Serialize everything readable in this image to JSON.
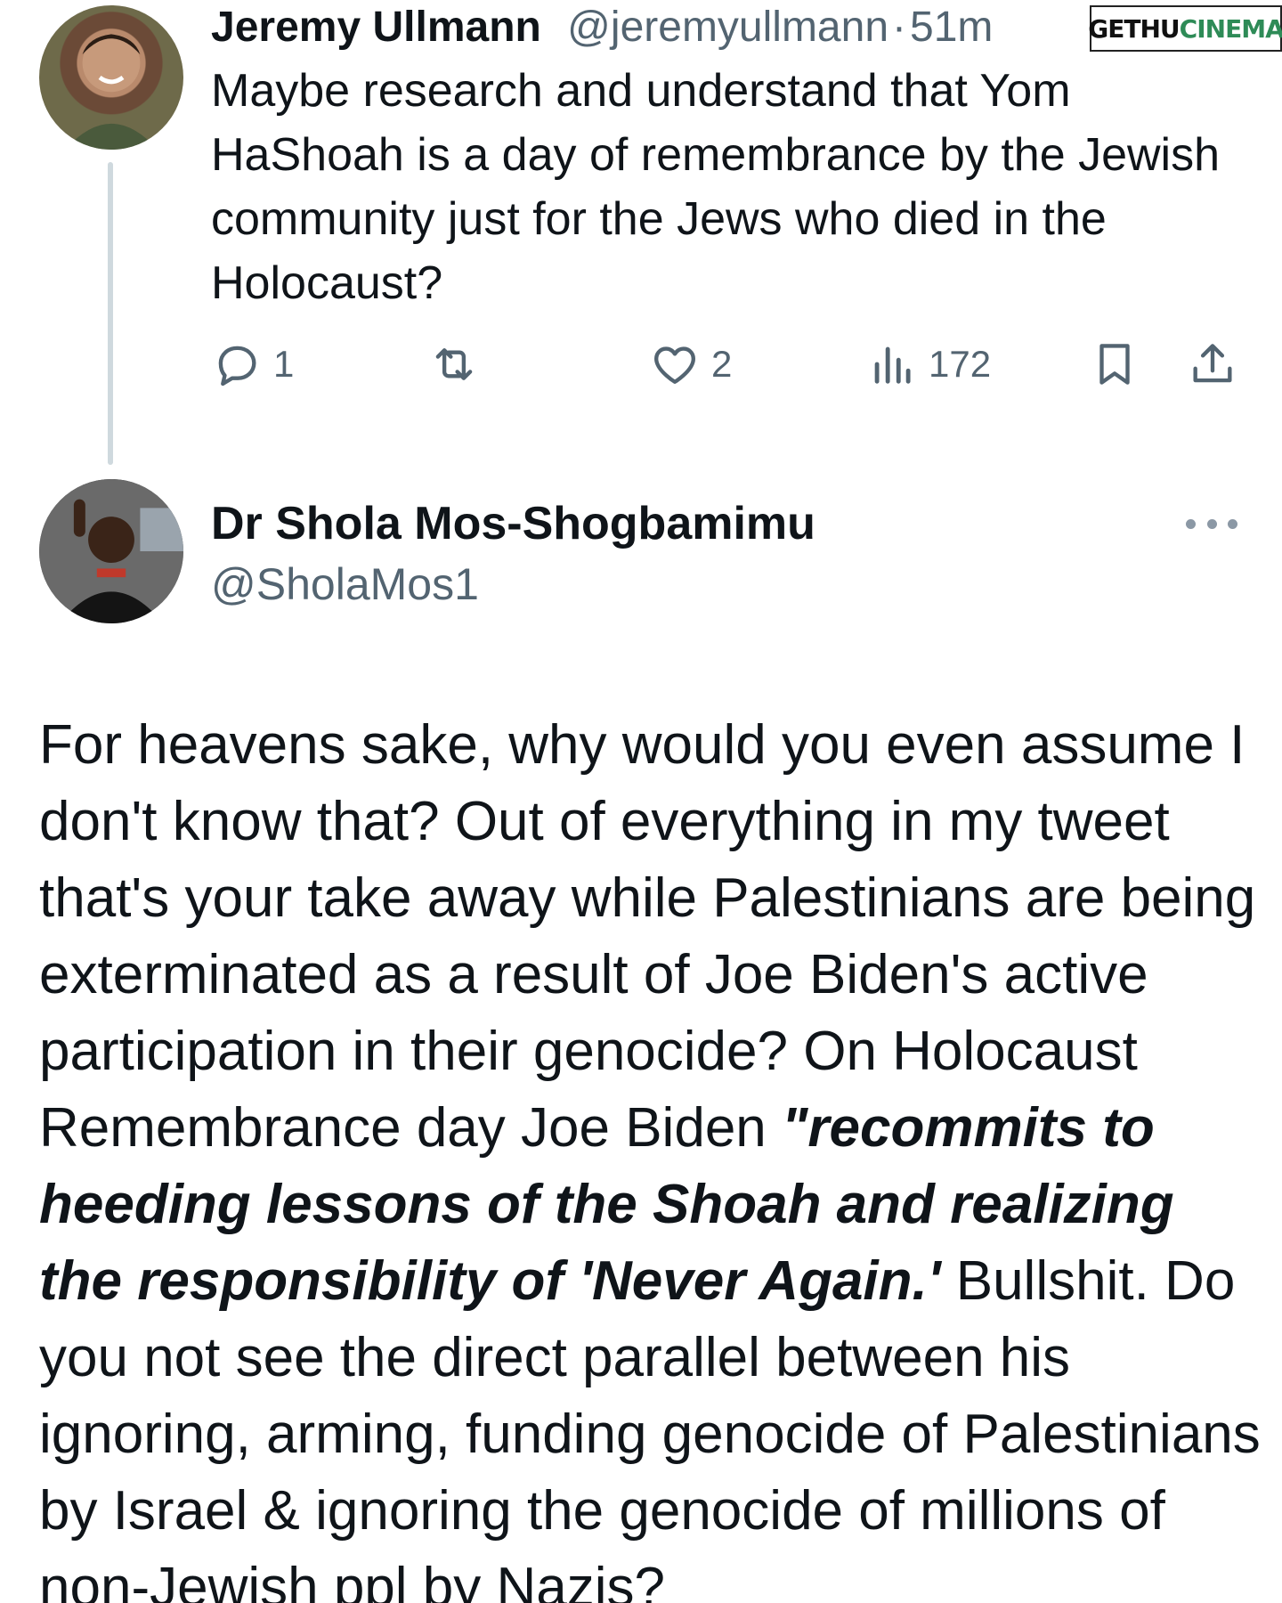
{
  "watermark": {
    "part1": "GETHU",
    "part2": "CINEMA"
  },
  "parent_tweet": {
    "author_name": "Jeremy Ullmann",
    "handle": "@jeremyullmann",
    "separator": "·",
    "time": "51m",
    "text": "Maybe research and understand that Yom HaShoah is a day of remembrance by the Jewish community just for the Jews who died in the Holocaust?",
    "replies": "1",
    "likes": "2",
    "views": "172"
  },
  "reply_tweet": {
    "author_name": "Dr Shola Mos-Shogbamimu",
    "handle": "@SholaMos1",
    "text_part1": "For heavens sake, why would you even assume I don't know that? Out of everything in my tweet that's your take away while Palestinians are being exterminated as a result of Joe Biden's active participation in their genocide? On Holocaust Remembrance day Joe Biden ",
    "text_quote": "\"recommits to heeding lessons of the Shoah and realizing the responsibility of 'Never Again.'",
    "text_part2": " Bullshit. Do you not see the direct parallel between his ignoring, arming, funding genocide of Palestinians by Israel & ignoring the genocide of millions of non-Jewish ppl by Nazis?"
  },
  "icons": {
    "reply": "speech-bubble-icon",
    "retweet": "retweet-icon",
    "like": "heart-icon",
    "views": "bar-chart-icon",
    "bookmark": "bookmark-icon",
    "share": "share-icon",
    "more": "more-dots-icon"
  },
  "colors": {
    "text": "#0f1419",
    "muted": "#536471",
    "thread_line": "#cfd9de",
    "background": "#ffffff"
  }
}
